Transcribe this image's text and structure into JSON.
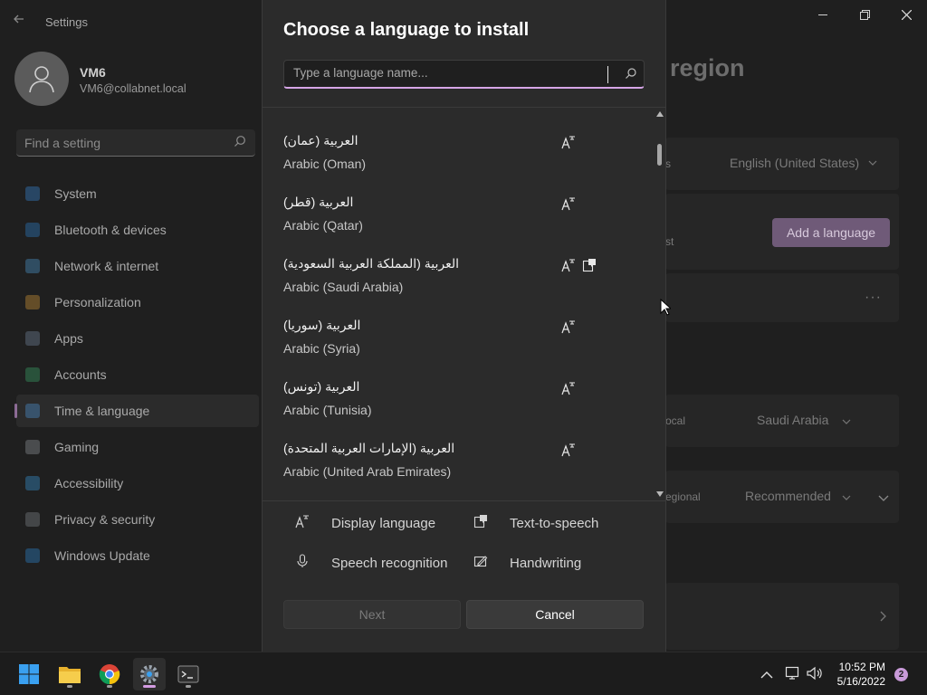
{
  "settings": {
    "app_title": "Settings",
    "user": {
      "name": "VM6",
      "email": "VM6@collabnet.local"
    },
    "find_placeholder": "Find a setting",
    "nav": [
      {
        "label": "System",
        "color": "#3a8ee6"
      },
      {
        "label": "Bluetooth & devices",
        "color": "#2f86d8"
      },
      {
        "label": "Network & internet",
        "color": "#4fa3e0"
      },
      {
        "label": "Personalization",
        "color": "#e6a23a"
      },
      {
        "label": "Apps",
        "color": "#7a8fa8"
      },
      {
        "label": "Accounts",
        "color": "#3cb371"
      },
      {
        "label": "Time & language",
        "color": "#4f9fe6",
        "selected": true
      },
      {
        "label": "Gaming",
        "color": "#9aa0a6"
      },
      {
        "label": "Accessibility",
        "color": "#3aa0e8"
      },
      {
        "label": "Privacy & security",
        "color": "#8a8f96"
      },
      {
        "label": "Windows Update",
        "color": "#2f8fe0"
      }
    ],
    "page_title_partial": "region",
    "background": {
      "windows_display_language": "English (United States)",
      "add_language_label": "Add a language",
      "country": "Saudi Arabia",
      "regional_format": "Recommended",
      "country_label_partial": "ocal",
      "regional_label_partial": "egional",
      "s_partial": "s",
      "st_partial": "st"
    }
  },
  "dialog": {
    "title": "Choose a language to install",
    "search_placeholder": "Type a language name...",
    "partial_row_text": "...",
    "languages": [
      {
        "native": "العربية (عمان)",
        "english": "Arabic (Oman)",
        "display": true,
        "tts": false
      },
      {
        "native": "العربية (قطر)",
        "english": "Arabic (Qatar)",
        "display": true,
        "tts": false
      },
      {
        "native": "العربية (المملكة العربية السعودية)",
        "english": "Arabic (Saudi Arabia)",
        "display": true,
        "tts": true
      },
      {
        "native": "العربية (سوريا)",
        "english": "Arabic (Syria)",
        "display": true,
        "tts": false
      },
      {
        "native": "العربية (تونس)",
        "english": "Arabic (Tunisia)",
        "display": true,
        "tts": false
      },
      {
        "native": "العربية (الإمارات العربية المتحدة)",
        "english": "Arabic (United Arab Emirates)",
        "display": true,
        "tts": false
      }
    ],
    "legend": {
      "display_language": "Display language",
      "text_to_speech": "Text-to-speech",
      "speech_recognition": "Speech recognition",
      "handwriting": "Handwriting"
    },
    "next_label": "Next",
    "cancel_label": "Cancel",
    "scroll_fraction": 0.06
  },
  "taskbar": {
    "time": "10:52 PM",
    "date": "5/16/2022",
    "notification_count": "2",
    "apps": [
      "start-icon",
      "file-explorer-icon",
      "chrome-icon",
      "settings-icon",
      "terminal-icon"
    ]
  }
}
